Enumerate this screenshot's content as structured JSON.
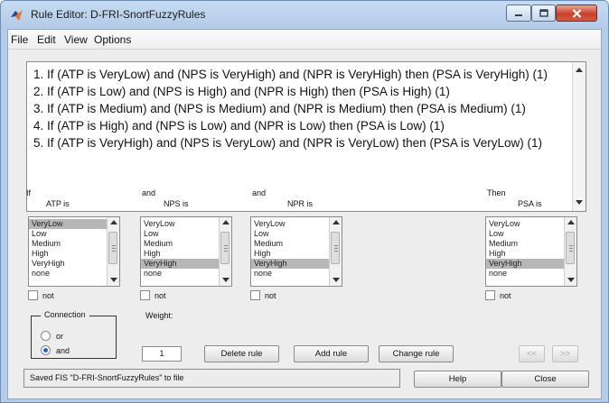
{
  "window": {
    "title": "Rule Editor: D-FRI-SnortFuzzyRules"
  },
  "menu": [
    "File",
    "Edit",
    "View",
    "Options"
  ],
  "rules": [
    "1. If (ATP is VeryLow) and (NPS is VeryHigh) and (NPR is VeryHigh) then (PSA is VeryHigh) (1)",
    "2. If (ATP is Low) and (NPS is High) and (NPR is High) then (PSA is High) (1)",
    "3. If (ATP is Medium) and (NPS is Medium) and (NPR is Medium) then (PSA is Medium) (1)",
    "4. If (ATP is High) and (NPS is Low) and (NPR is Low) then (PSA is Low) (1)",
    "5. If (ATP is VeryHigh) and (NPS is VeryLow) and (NPR is VeryLow) then (PSA is VeryLow) (1)"
  ],
  "variables": [
    {
      "prefix": "If",
      "name": "ATP is",
      "options": [
        "VeryLow",
        "Low",
        "Medium",
        "High",
        "VeryHigh",
        "none"
      ],
      "selected": "VeryLow",
      "not_label": "not"
    },
    {
      "prefix": "and",
      "name": "NPS is",
      "options": [
        "VeryLow",
        "Low",
        "Medium",
        "High",
        "VeryHigh",
        "none"
      ],
      "selected": "VeryHigh",
      "not_label": "not"
    },
    {
      "prefix": "and",
      "name": "NPR is",
      "options": [
        "VeryLow",
        "Low",
        "Medium",
        "High",
        "VeryHigh",
        "none"
      ],
      "selected": "VeryHigh",
      "not_label": "not"
    },
    {
      "prefix": "Then",
      "name": "PSA is",
      "options": [
        "VeryLow",
        "Low",
        "Medium",
        "High",
        "VeryHigh",
        "none"
      ],
      "selected": "VeryHigh",
      "not_label": "not"
    }
  ],
  "connection": {
    "title": "Connection",
    "options": [
      "or",
      "and"
    ],
    "selected": "and"
  },
  "weight": {
    "label": "Weight:",
    "value": "1"
  },
  "buttons": {
    "delete": "Delete rule",
    "add": "Add rule",
    "change": "Change rule",
    "prev": "<<",
    "next": ">>",
    "help": "Help",
    "close": "Close"
  },
  "status": "Saved FIS \"D-FRI-SnortFuzzyRules\" to file",
  "icons": {
    "app": "matlab-logo-icon",
    "minimize": "minimize-icon",
    "maximize": "maximize-icon",
    "close": "close-icon"
  },
  "colors": {
    "selection": "#b7b7b7",
    "close_button": "#c7412c",
    "title_bar": "#b4cce8"
  }
}
